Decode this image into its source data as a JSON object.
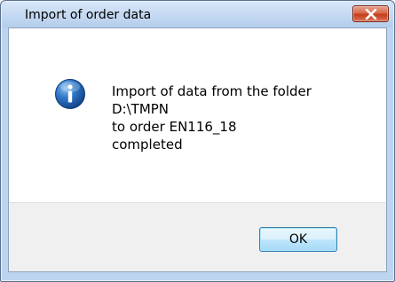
{
  "window": {
    "title": "Import of order data",
    "close_icon": "close-icon"
  },
  "message": {
    "icon": "info-icon",
    "lines": [
      "Import of data from the folder",
      "D:\\TMPN",
      "to order EN116_18",
      "completed"
    ]
  },
  "buttons": {
    "ok_label": "OK"
  },
  "colors": {
    "close_button": "#c43d18",
    "info_icon": "#1f5fae",
    "ok_button_border": "#3c7fb1"
  }
}
